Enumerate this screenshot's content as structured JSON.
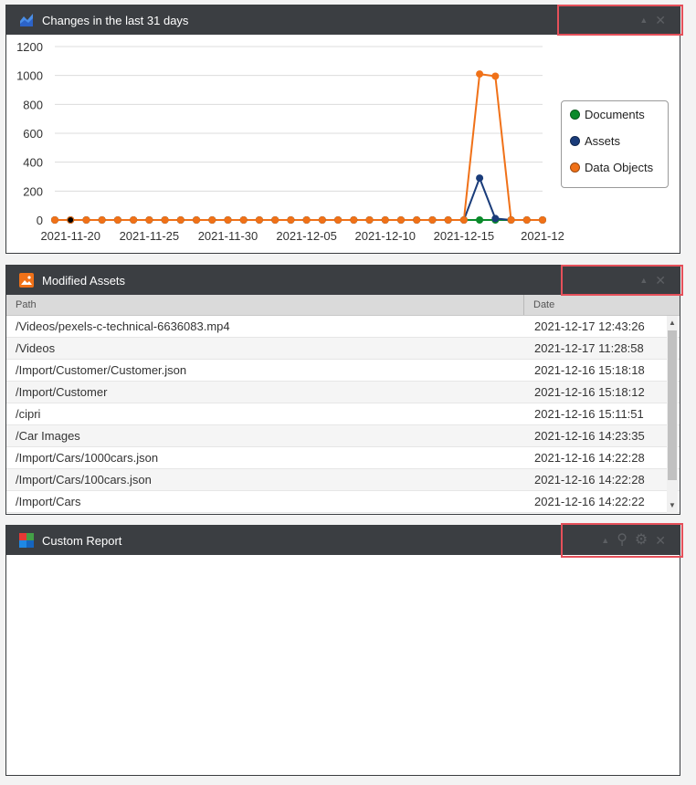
{
  "panels": {
    "changes": {
      "title": "Changes in the last 31 days",
      "tools": {
        "collapse": "▲",
        "close": "✕"
      }
    },
    "assets": {
      "title": "Modified Assets",
      "tools": {
        "collapse": "▲",
        "close": "✕"
      },
      "columns": {
        "path": "Path",
        "date": "Date"
      },
      "rows": [
        {
          "path": "/Videos/pexels-c-technical-6636083.mp4",
          "date": "2021-12-17 12:43:26"
        },
        {
          "path": "/Videos",
          "date": "2021-12-17 11:28:58"
        },
        {
          "path": "/Import/Customer/Customer.json",
          "date": "2021-12-16 15:18:18"
        },
        {
          "path": "/Import/Customer",
          "date": "2021-12-16 15:18:12"
        },
        {
          "path": "/cipri",
          "date": "2021-12-16 15:11:51"
        },
        {
          "path": "/Car Images",
          "date": "2021-12-16 14:23:35"
        },
        {
          "path": "/Import/Cars/1000cars.json",
          "date": "2021-12-16 14:22:28"
        },
        {
          "path": "/Import/Cars/100cars.json",
          "date": "2021-12-16 14:22:28"
        },
        {
          "path": "/Import/Cars",
          "date": "2021-12-16 14:22:22"
        }
      ]
    },
    "report": {
      "title": "Custom Report",
      "tools": {
        "collapse": "▲",
        "search": "⚲",
        "settings": "⚙",
        "close": "✕"
      }
    }
  },
  "chart_data": {
    "type": "line",
    "x": [
      "2021-11-19",
      "2021-11-20",
      "2021-11-21",
      "2021-11-22",
      "2021-11-23",
      "2021-11-24",
      "2021-11-25",
      "2021-11-26",
      "2021-11-27",
      "2021-11-28",
      "2021-11-29",
      "2021-11-30",
      "2021-12-01",
      "2021-12-02",
      "2021-12-03",
      "2021-12-04",
      "2021-12-05",
      "2021-12-06",
      "2021-12-07",
      "2021-12-08",
      "2021-12-09",
      "2021-12-10",
      "2021-12-11",
      "2021-12-12",
      "2021-12-13",
      "2021-12-14",
      "2021-12-15",
      "2021-12-16",
      "2021-12-17",
      "2021-12-18",
      "2021-12-19",
      "2021-12-20"
    ],
    "x_tick_labels": [
      "2021-11-20",
      "2021-11-25",
      "2021-11-30",
      "2021-12-05",
      "2021-12-10",
      "2021-12-15",
      "2021-12-20"
    ],
    "x_tick_label_display": [
      "2021-11-20",
      "2021-11-25",
      "2021-11-30",
      "2021-12-05",
      "2021-12-10",
      "2021-12-15",
      "2021-12"
    ],
    "ylim": [
      0,
      1200
    ],
    "y_ticks": [
      0,
      200,
      400,
      600,
      800,
      1000,
      1200
    ],
    "grid": true,
    "legend_position": "right",
    "series": [
      {
        "name": "Documents",
        "color": "#0a8a2a",
        "values": [
          0,
          0,
          0,
          0,
          0,
          0,
          0,
          0,
          0,
          0,
          0,
          0,
          0,
          0,
          0,
          0,
          0,
          0,
          0,
          0,
          0,
          0,
          0,
          0,
          0,
          0,
          0,
          0,
          0,
          0,
          0,
          0
        ]
      },
      {
        "name": "Assets",
        "color": "#1a3c7a",
        "values": [
          0,
          0,
          0,
          0,
          0,
          0,
          0,
          0,
          0,
          0,
          0,
          0,
          0,
          0,
          0,
          0,
          0,
          0,
          0,
          0,
          0,
          0,
          0,
          0,
          0,
          0,
          0,
          290,
          10,
          0,
          0,
          0
        ]
      },
      {
        "name": "Data Objects",
        "color": "#f07118",
        "values": [
          0,
          0,
          0,
          0,
          0,
          0,
          0,
          0,
          0,
          0,
          0,
          0,
          0,
          0,
          0,
          0,
          0,
          0,
          0,
          0,
          0,
          0,
          0,
          0,
          0,
          0,
          0,
          1010,
          995,
          0,
          0,
          0
        ]
      }
    ]
  }
}
